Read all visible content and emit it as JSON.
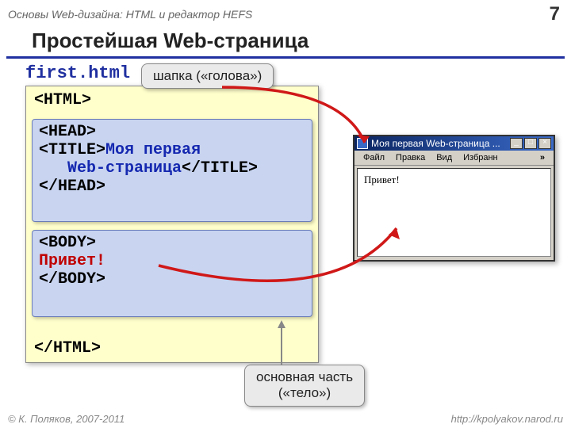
{
  "header": {
    "breadcrumb": "Основы Web-дизайна: HTML и редактор HEFS",
    "page_num": "7"
  },
  "title": "Простейшая Web-страница",
  "filename": "first.html",
  "callouts": {
    "head": "шапка («голова»)",
    "body_l1": "основная часть",
    "body_l2": "(«тело»)"
  },
  "code": {
    "open_html": "<HTML>",
    "open_head": "<HEAD>",
    "title_open": "<TITLE>",
    "title_text1": "Моя первая",
    "title_text2_indent": "   Web-страница",
    "title_close": "</TITLE>",
    "close_head": "</HEAD>",
    "open_body": "<BODY>",
    "body_text": "Привет!",
    "close_body": "</BODY>",
    "close_html": "</HTML>"
  },
  "browser": {
    "title": "Моя первая Web-страница ...",
    "menu": {
      "file": "Файл",
      "edit": "Правка",
      "view": "Вид",
      "fav": "Избранн",
      "more": "»"
    },
    "win": {
      "min": "_",
      "max": "□",
      "close": "×"
    },
    "content": "Привет!"
  },
  "footer": {
    "copyright": "© К. Поляков, 2007-2011",
    "url": "http://kpolyakov.narod.ru"
  }
}
